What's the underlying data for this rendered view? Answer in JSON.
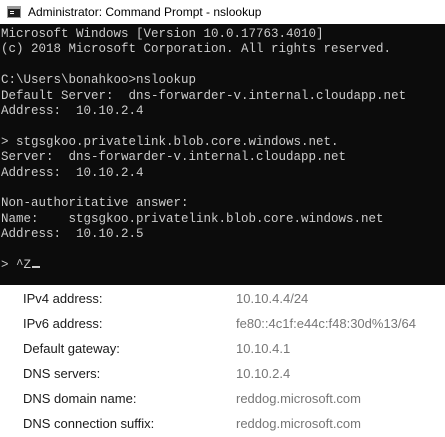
{
  "window": {
    "title": "Administrator: Command Prompt - nslookup"
  },
  "console": {
    "lines": [
      "Microsoft Windows [Version 10.0.17763.4010]",
      "(c) 2018 Microsoft Corporation. All rights reserved.",
      "",
      "C:\\Users\\bonahkoo>nslookup",
      "Default Server:  dns-forwarder-v.internal.cloudapp.net",
      "Address:  10.10.2.4",
      "",
      "> stgsgkoo.privatelink.blob.core.windows.net.",
      "Server:  dns-forwarder-v.internal.cloudapp.net",
      "Address:  10.10.2.4",
      "",
      "Non-authoritative answer:",
      "Name:    stgsgkoo.privatelink.blob.core.windows.net",
      "Address:  10.10.2.5",
      "",
      "> ^Z"
    ]
  },
  "network_properties": [
    {
      "label": "IPv4 address:",
      "value": "10.10.4.4/24"
    },
    {
      "label": "IPv6 address:",
      "value": "fe80::4c1f:e44c:f48:30d%13/64"
    },
    {
      "label": "Default gateway:",
      "value": "10.10.4.1"
    },
    {
      "label": "DNS servers:",
      "value": "10.10.2.4"
    },
    {
      "label": "DNS domain name:",
      "value": "reddog.microsoft.com"
    },
    {
      "label": "DNS connection suffix:",
      "value": "reddog.microsoft.com"
    }
  ]
}
